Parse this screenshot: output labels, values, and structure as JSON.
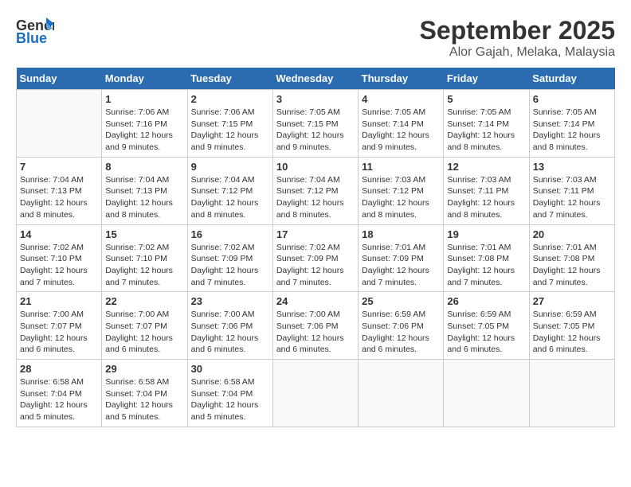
{
  "header": {
    "logo_general": "General",
    "logo_blue": "Blue",
    "month_title": "September 2025",
    "location": "Alor Gajah, Melaka, Malaysia"
  },
  "days_of_week": [
    "Sunday",
    "Monday",
    "Tuesday",
    "Wednesday",
    "Thursday",
    "Friday",
    "Saturday"
  ],
  "weeks": [
    [
      {
        "day": "",
        "info": ""
      },
      {
        "day": "1",
        "info": "Sunrise: 7:06 AM\nSunset: 7:16 PM\nDaylight: 12 hours\nand 9 minutes."
      },
      {
        "day": "2",
        "info": "Sunrise: 7:06 AM\nSunset: 7:15 PM\nDaylight: 12 hours\nand 9 minutes."
      },
      {
        "day": "3",
        "info": "Sunrise: 7:05 AM\nSunset: 7:15 PM\nDaylight: 12 hours\nand 9 minutes."
      },
      {
        "day": "4",
        "info": "Sunrise: 7:05 AM\nSunset: 7:14 PM\nDaylight: 12 hours\nand 9 minutes."
      },
      {
        "day": "5",
        "info": "Sunrise: 7:05 AM\nSunset: 7:14 PM\nDaylight: 12 hours\nand 8 minutes."
      },
      {
        "day": "6",
        "info": "Sunrise: 7:05 AM\nSunset: 7:14 PM\nDaylight: 12 hours\nand 8 minutes."
      }
    ],
    [
      {
        "day": "7",
        "info": "Sunrise: 7:04 AM\nSunset: 7:13 PM\nDaylight: 12 hours\nand 8 minutes."
      },
      {
        "day": "8",
        "info": "Sunrise: 7:04 AM\nSunset: 7:13 PM\nDaylight: 12 hours\nand 8 minutes."
      },
      {
        "day": "9",
        "info": "Sunrise: 7:04 AM\nSunset: 7:12 PM\nDaylight: 12 hours\nand 8 minutes."
      },
      {
        "day": "10",
        "info": "Sunrise: 7:04 AM\nSunset: 7:12 PM\nDaylight: 12 hours\nand 8 minutes."
      },
      {
        "day": "11",
        "info": "Sunrise: 7:03 AM\nSunset: 7:12 PM\nDaylight: 12 hours\nand 8 minutes."
      },
      {
        "day": "12",
        "info": "Sunrise: 7:03 AM\nSunset: 7:11 PM\nDaylight: 12 hours\nand 8 minutes."
      },
      {
        "day": "13",
        "info": "Sunrise: 7:03 AM\nSunset: 7:11 PM\nDaylight: 12 hours\nand 7 minutes."
      }
    ],
    [
      {
        "day": "14",
        "info": "Sunrise: 7:02 AM\nSunset: 7:10 PM\nDaylight: 12 hours\nand 7 minutes."
      },
      {
        "day": "15",
        "info": "Sunrise: 7:02 AM\nSunset: 7:10 PM\nDaylight: 12 hours\nand 7 minutes."
      },
      {
        "day": "16",
        "info": "Sunrise: 7:02 AM\nSunset: 7:09 PM\nDaylight: 12 hours\nand 7 minutes."
      },
      {
        "day": "17",
        "info": "Sunrise: 7:02 AM\nSunset: 7:09 PM\nDaylight: 12 hours\nand 7 minutes."
      },
      {
        "day": "18",
        "info": "Sunrise: 7:01 AM\nSunset: 7:09 PM\nDaylight: 12 hours\nand 7 minutes."
      },
      {
        "day": "19",
        "info": "Sunrise: 7:01 AM\nSunset: 7:08 PM\nDaylight: 12 hours\nand 7 minutes."
      },
      {
        "day": "20",
        "info": "Sunrise: 7:01 AM\nSunset: 7:08 PM\nDaylight: 12 hours\nand 7 minutes."
      }
    ],
    [
      {
        "day": "21",
        "info": "Sunrise: 7:00 AM\nSunset: 7:07 PM\nDaylight: 12 hours\nand 6 minutes."
      },
      {
        "day": "22",
        "info": "Sunrise: 7:00 AM\nSunset: 7:07 PM\nDaylight: 12 hours\nand 6 minutes."
      },
      {
        "day": "23",
        "info": "Sunrise: 7:00 AM\nSunset: 7:06 PM\nDaylight: 12 hours\nand 6 minutes."
      },
      {
        "day": "24",
        "info": "Sunrise: 7:00 AM\nSunset: 7:06 PM\nDaylight: 12 hours\nand 6 minutes."
      },
      {
        "day": "25",
        "info": "Sunrise: 6:59 AM\nSunset: 7:06 PM\nDaylight: 12 hours\nand 6 minutes."
      },
      {
        "day": "26",
        "info": "Sunrise: 6:59 AM\nSunset: 7:05 PM\nDaylight: 12 hours\nand 6 minutes."
      },
      {
        "day": "27",
        "info": "Sunrise: 6:59 AM\nSunset: 7:05 PM\nDaylight: 12 hours\nand 6 minutes."
      }
    ],
    [
      {
        "day": "28",
        "info": "Sunrise: 6:58 AM\nSunset: 7:04 PM\nDaylight: 12 hours\nand 5 minutes."
      },
      {
        "day": "29",
        "info": "Sunrise: 6:58 AM\nSunset: 7:04 PM\nDaylight: 12 hours\nand 5 minutes."
      },
      {
        "day": "30",
        "info": "Sunrise: 6:58 AM\nSunset: 7:04 PM\nDaylight: 12 hours\nand 5 minutes."
      },
      {
        "day": "",
        "info": ""
      },
      {
        "day": "",
        "info": ""
      },
      {
        "day": "",
        "info": ""
      },
      {
        "day": "",
        "info": ""
      }
    ]
  ]
}
